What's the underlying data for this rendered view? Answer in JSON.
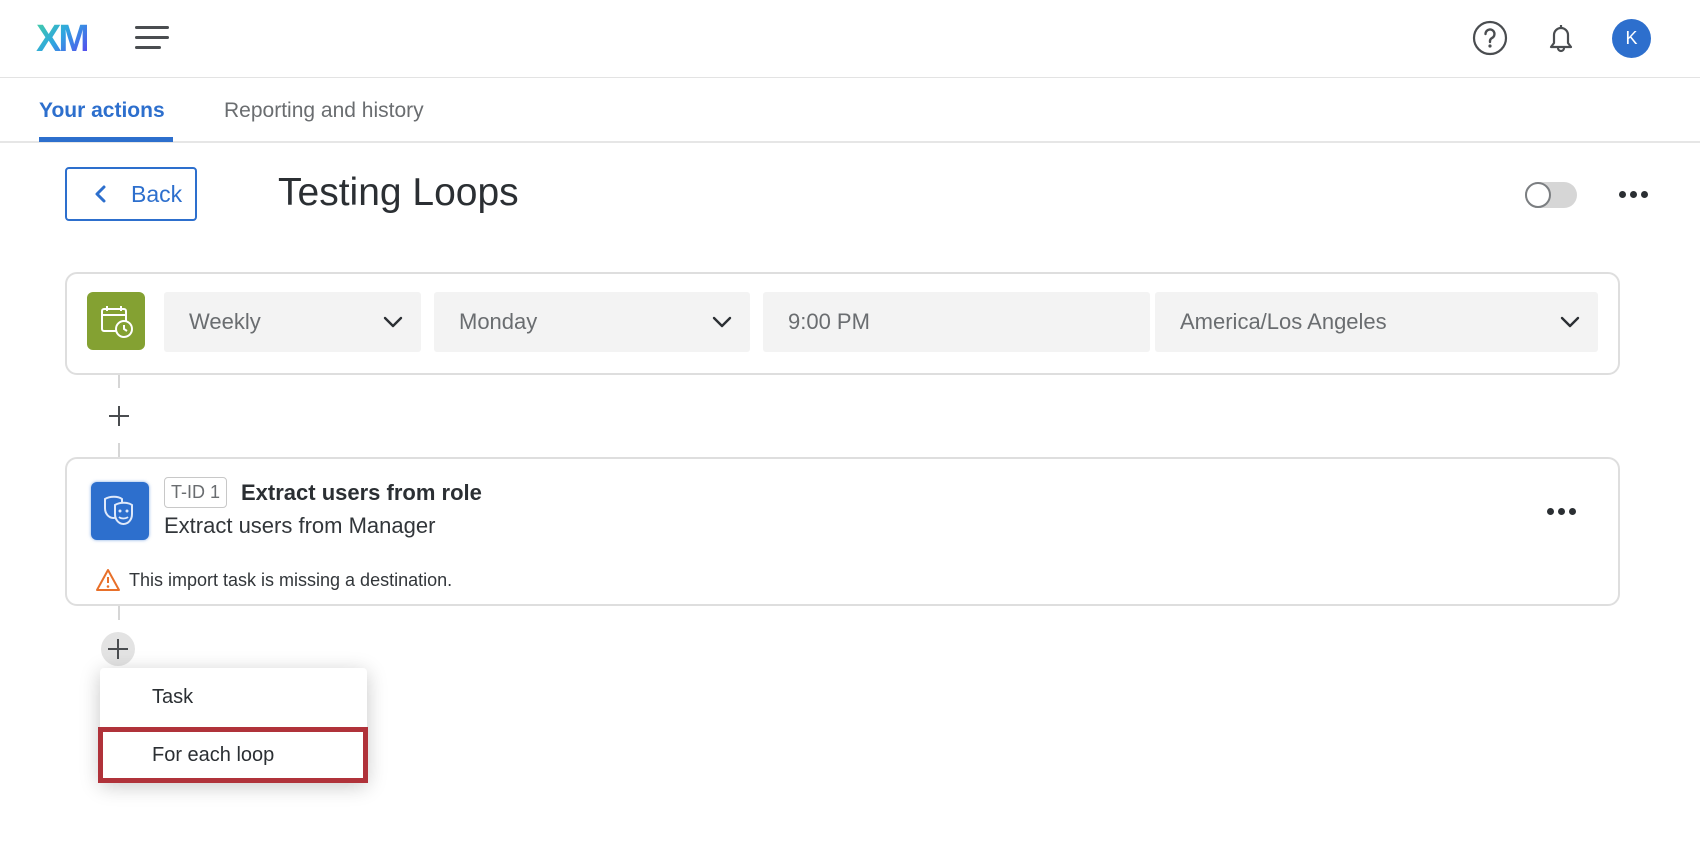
{
  "header": {
    "logo": "XM",
    "icons": [
      "menu-icon",
      "help-icon",
      "bell-icon"
    ],
    "avatar_initial": "K",
    "accent_color": "#2d6fcd"
  },
  "tabs": [
    {
      "label": "Your actions",
      "active": true
    },
    {
      "label": "Reporting and history",
      "active": false
    }
  ],
  "page": {
    "back_label": "Back",
    "title": "Testing Loops",
    "enabled": false
  },
  "schedule": {
    "icon": "calendar-clock-icon",
    "frequency": "Weekly",
    "day": "Monday",
    "time": "9:00 PM",
    "timezone": "America/Los Angeles"
  },
  "task": {
    "id_badge": "T-ID 1",
    "title": "Extract users from role",
    "subtitle": "Extract users from Manager",
    "warning": "This import task is missing a destination.",
    "icon": "masks-icon"
  },
  "add_menu": {
    "items": [
      {
        "label": "Task",
        "highlighted": false
      },
      {
        "label": "For each loop",
        "highlighted": true
      }
    ],
    "highlight_color": "#b0323a"
  }
}
